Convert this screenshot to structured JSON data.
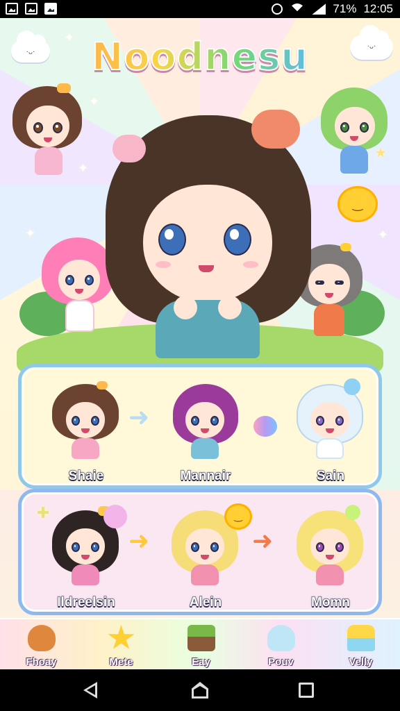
{
  "status_bar": {
    "battery": "71%",
    "time": "12:05"
  },
  "game": {
    "title": "Noodnesu",
    "cloud_face": "·ᴗ·",
    "sun_face": "‿",
    "row1": [
      {
        "name": "Shaie"
      },
      {
        "name": "Mannair"
      },
      {
        "name": "Sain"
      }
    ],
    "row2": [
      {
        "name": "Ildreelsin"
      },
      {
        "name": "Alein"
      },
      {
        "name": "Momn"
      }
    ],
    "arrow_glyph": "➜",
    "nav": [
      {
        "label": "Fhoay",
        "icon": "cookie-icon"
      },
      {
        "label": "Mete",
        "icon": "star-heart-icon"
      },
      {
        "label": "Eay",
        "icon": "cake-icon"
      },
      {
        "label": "Pouv",
        "icon": "ghost-icon"
      },
      {
        "label": "Velly",
        "icon": "pudding-icon"
      }
    ],
    "colors": {
      "panel_border": "#8fc8e8",
      "grass": "#a7d96a",
      "title_pink": "#ff6fa0"
    }
  }
}
